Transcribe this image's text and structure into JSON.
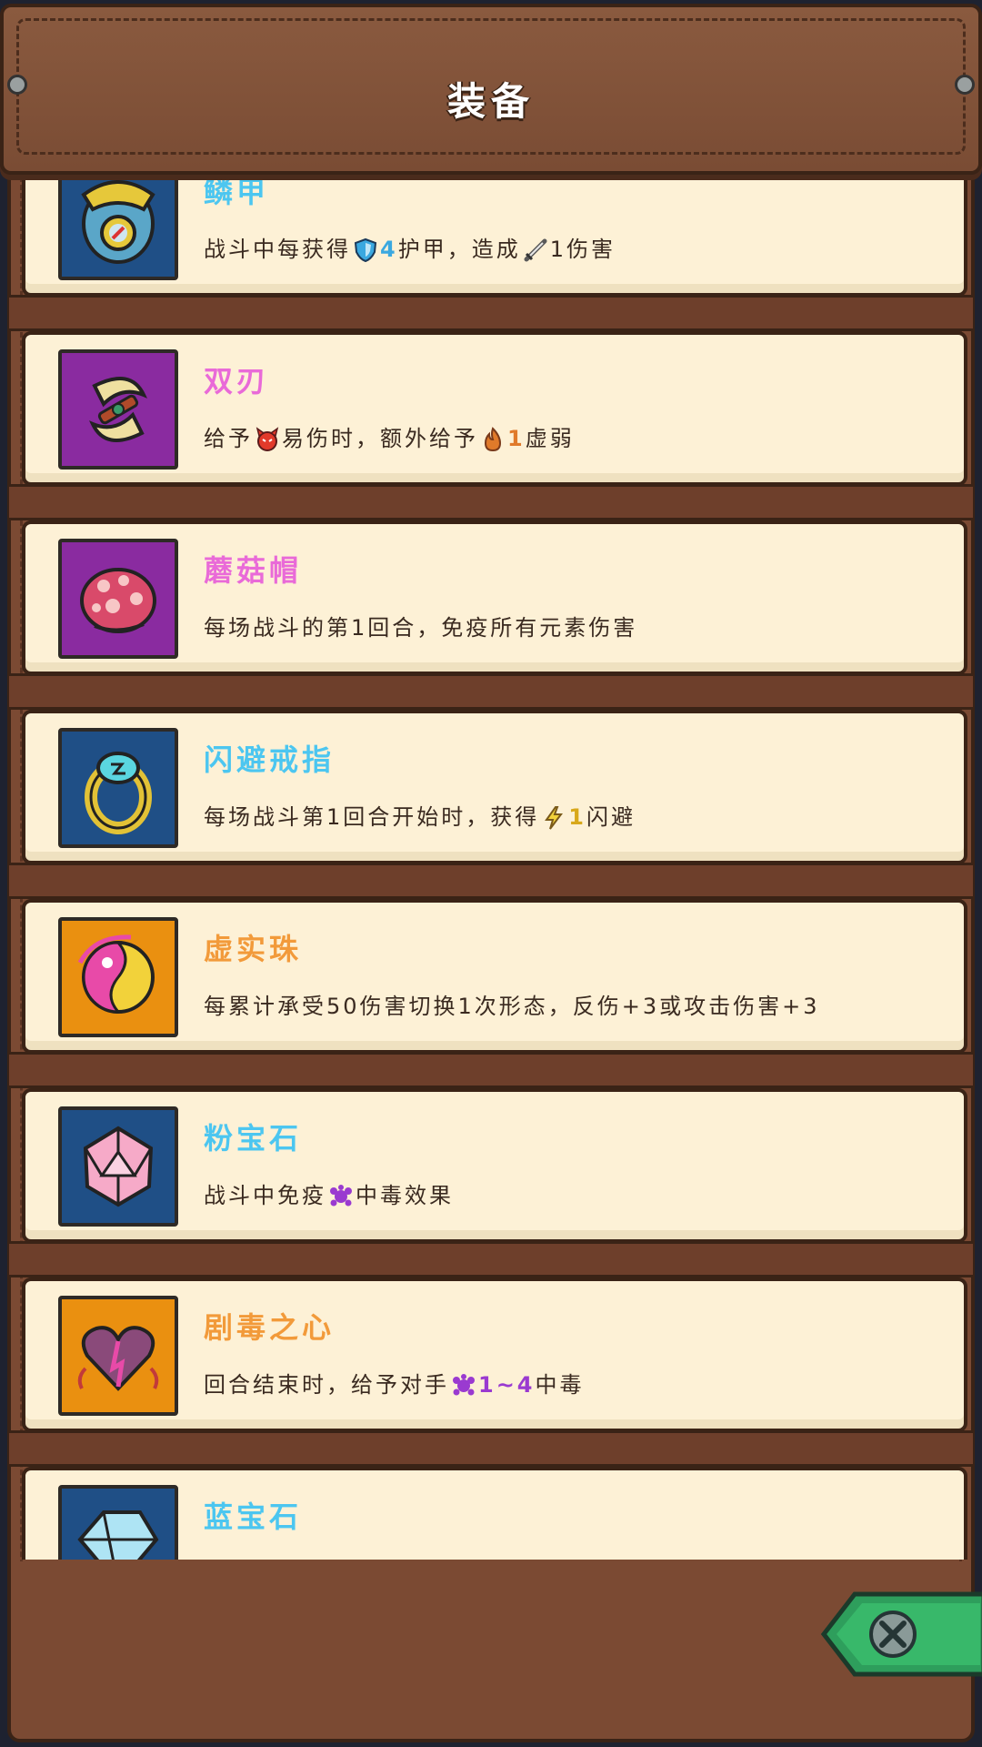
{
  "header": {
    "title": "装备"
  },
  "items": [
    {
      "name": "鳞甲",
      "name_color": "#4cc6f0",
      "icon_bg": "#1f4f86",
      "icon": "armor-icon",
      "desc": [
        {
          "t": "text",
          "v": "战斗中每获得"
        },
        {
          "t": "glyph",
          "icon": "shield-icon"
        },
        {
          "t": "num",
          "v": "4",
          "color": "#3aa8e0"
        },
        {
          "t": "text",
          "v": "护甲，造成"
        },
        {
          "t": "glyph",
          "icon": "sword-icon"
        },
        {
          "t": "text",
          "v": "1伤害"
        }
      ]
    },
    {
      "name": "双刃",
      "name_color": "#e96ad8",
      "icon_bg": "#8a2ba0",
      "icon": "twin-blades-icon",
      "desc": [
        {
          "t": "text",
          "v": "给予"
        },
        {
          "t": "glyph",
          "icon": "devil-icon"
        },
        {
          "t": "text",
          "v": "易伤时，额外给予"
        },
        {
          "t": "glyph",
          "icon": "flame-icon"
        },
        {
          "t": "num",
          "v": "1",
          "color": "#e07a2a"
        },
        {
          "t": "text",
          "v": "虚弱"
        }
      ]
    },
    {
      "name": "蘑菇帽",
      "name_color": "#e96ad8",
      "icon_bg": "#8a2ba0",
      "icon": "mushroom-cap-icon",
      "desc": [
        {
          "t": "text",
          "v": "每场战斗的第1回合，免疫所有元素伤害"
        }
      ]
    },
    {
      "name": "闪避戒指",
      "name_color": "#4cc6f0",
      "icon_bg": "#1f4f86",
      "icon": "ring-icon",
      "desc": [
        {
          "t": "text",
          "v": "每场战斗第1回合开始时，获得"
        },
        {
          "t": "glyph",
          "icon": "lightning-icon"
        },
        {
          "t": "num",
          "v": "1",
          "color": "#d8a81a"
        },
        {
          "t": "text",
          "v": "闪避"
        }
      ]
    },
    {
      "name": "虚实珠",
      "name_color": "#f29a3a",
      "icon_bg": "#ea9010",
      "icon": "yin-yang-orb-icon",
      "desc": [
        {
          "t": "text",
          "v": "每累计承受50伤害切换1次形态，反伤+3或攻击伤害+3"
        }
      ]
    },
    {
      "name": "粉宝石",
      "name_color": "#4cc6f0",
      "icon_bg": "#1f4f86",
      "icon": "pink-gem-icon",
      "desc": [
        {
          "t": "text",
          "v": "战斗中免疫"
        },
        {
          "t": "glyph",
          "icon": "poison-icon"
        },
        {
          "t": "text",
          "v": "中毒效果"
        }
      ]
    },
    {
      "name": "剧毒之心",
      "name_color": "#f29a3a",
      "icon_bg": "#ea9010",
      "icon": "toxic-heart-icon",
      "desc": [
        {
          "t": "text",
          "v": "回合结束时，给予对手"
        },
        {
          "t": "glyph",
          "icon": "poison-icon"
        },
        {
          "t": "num",
          "v": "1~4",
          "color": "#9a3ad0"
        },
        {
          "t": "text",
          "v": "中毒"
        }
      ]
    },
    {
      "name": "蓝宝石",
      "name_color": "#4cc6f0",
      "icon_bg": "#1f4f86",
      "icon": "blue-gem-icon",
      "desc": []
    }
  ],
  "close_button": {
    "icon": "close-icon"
  }
}
